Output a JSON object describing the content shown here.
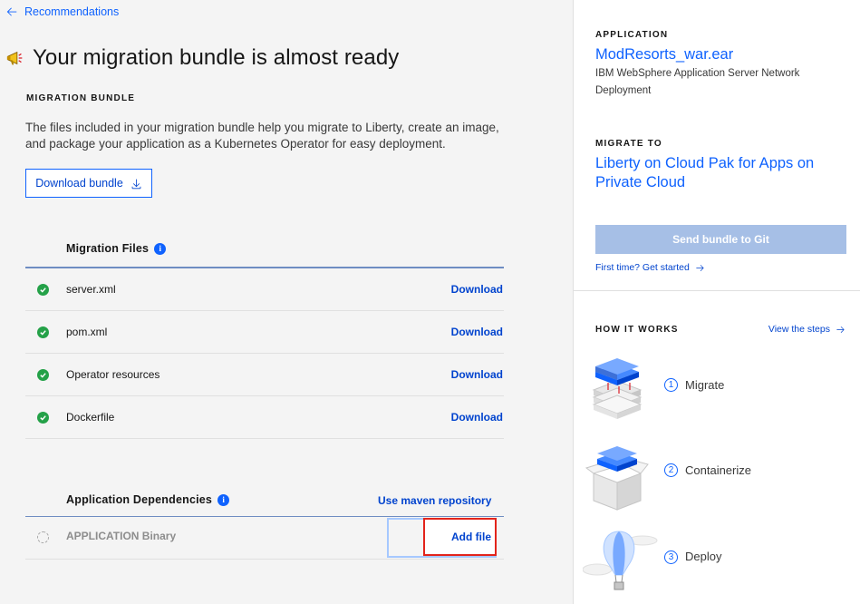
{
  "nav": {
    "back_label": "Recommendations"
  },
  "page": {
    "title": "Your migration bundle is almost ready"
  },
  "bundle": {
    "eyebrow": "MIGRATION BUNDLE",
    "description": "The files included in your migration bundle help you migrate to Liberty, create an image, and package your application as a Kubernetes Operator for easy deployment.",
    "download_label": "Download bundle"
  },
  "migration_files": {
    "title": "Migration Files",
    "rows": [
      {
        "name": "server.xml",
        "action": "Download",
        "status": "complete"
      },
      {
        "name": "pom.xml",
        "action": "Download",
        "status": "complete"
      },
      {
        "name": "Operator resources",
        "action": "Download",
        "status": "complete"
      },
      {
        "name": "Dockerfile",
        "action": "Download",
        "status": "complete"
      }
    ]
  },
  "dependencies": {
    "title": "Application Dependencies",
    "maven_label": "Use maven repository",
    "rows": [
      {
        "name": "APPLICATION Binary",
        "action": "Add file",
        "status": "pending"
      }
    ]
  },
  "sidebar": {
    "application_eyebrow": "APPLICATION",
    "application_name": "ModResorts_war.ear",
    "application_server": "IBM WebSphere Application Server Network Deployment",
    "migrate_eyebrow": "MIGRATE TO",
    "migrate_target": "Liberty on Cloud Pak for Apps on Private Cloud",
    "send_label": "Send bundle to Git",
    "first_time_label": "First time? Get started",
    "how_eyebrow": "HOW IT WORKS",
    "view_steps_label": "View the steps",
    "steps": [
      {
        "number": "1",
        "label": "Migrate"
      },
      {
        "number": "2",
        "label": "Containerize"
      },
      {
        "number": "3",
        "label": "Deploy"
      }
    ]
  },
  "colors": {
    "accent": "#0f62fe",
    "link": "#0043ce",
    "success": "#24a148",
    "disabled_button": "#a6bfe6",
    "highlight": "#e3241b"
  }
}
